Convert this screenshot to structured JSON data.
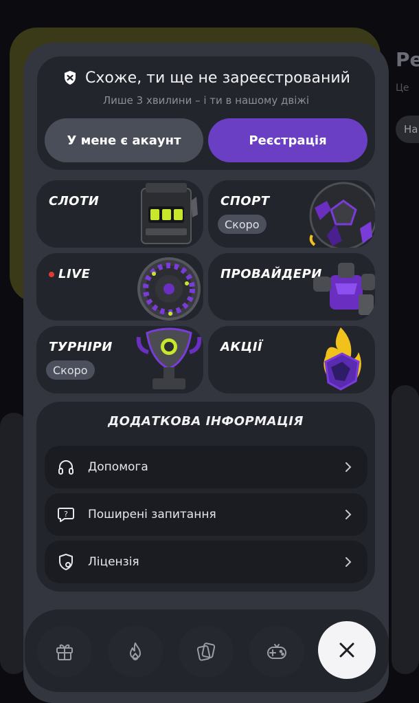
{
  "registration": {
    "title": "Схоже, ти ще не зареєстрований",
    "subtitle": "Лише 3 хвилини – і ти в нашому двіжі",
    "login_label": "У мене є акаунт",
    "register_label": "Реєстрація"
  },
  "tiles": {
    "slots": {
      "label": "СЛОТИ"
    },
    "sport": {
      "label": "СПОРТ",
      "badge": "Скоро"
    },
    "live": {
      "label": "LIVE"
    },
    "providers": {
      "label": "ПРОВАЙДЕРИ"
    },
    "tournaments": {
      "label": "ТУРНІРИ",
      "badge": "Скоро"
    },
    "promos": {
      "label": "АКЦІЇ"
    }
  },
  "info": {
    "title": "ДОДАТКОВА ІНФОРМАЦІЯ",
    "items": [
      {
        "label": "Допомога",
        "icon": "headphones-icon"
      },
      {
        "label": "Поширені запитання",
        "icon": "question-bubble-icon"
      },
      {
        "label": "Ліцензія",
        "icon": "license-shield-icon"
      }
    ]
  },
  "bottom_nav": {
    "items": [
      "gift-icon",
      "flame-icon",
      "cards-icon",
      "gamepad-icon"
    ],
    "close_icon": "close-icon"
  },
  "background": {
    "side_title": "Ре",
    "side_subtitle": "Це",
    "side_pill": "На"
  },
  "colors": {
    "accent": "#6a3fc4",
    "panel": "#33363f",
    "card": "#23252c",
    "live_dot": "#e53935",
    "neon": "#c8e62a"
  }
}
